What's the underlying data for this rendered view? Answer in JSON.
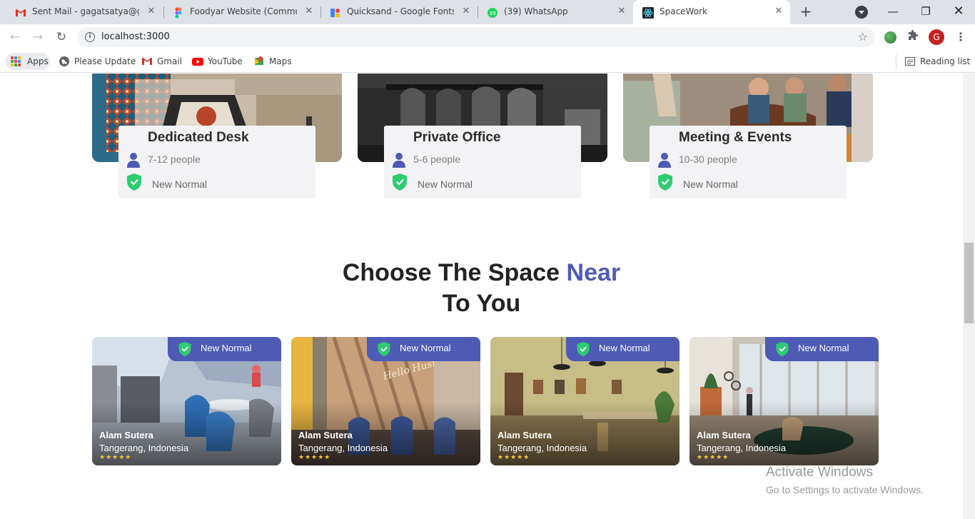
{
  "browser": {
    "tabs": [
      {
        "title": "Sent Mail - gagatsatya@gmail.com",
        "icon": "gmail-icon"
      },
      {
        "title": "Foodyar Website (Community)",
        "icon": "figma-icon"
      },
      {
        "title": "Quicksand - Google Fonts",
        "icon": "google-fonts-icon"
      },
      {
        "title": "(39) WhatsApp",
        "icon": "whatsapp-icon"
      },
      {
        "title": "SpaceWork",
        "icon": "react-icon",
        "active": true
      }
    ],
    "url": "localhost:3000",
    "profile_initial": "G",
    "bookmarks": {
      "apps": "Apps",
      "items": [
        {
          "label": "Please Update",
          "icon": "globe-icon"
        },
        {
          "label": "Gmail",
          "icon": "gmail-icon"
        },
        {
          "label": "YouTube",
          "icon": "youtube-icon"
        },
        {
          "label": "Maps",
          "icon": "maps-icon"
        }
      ],
      "reading_list": "Reading list"
    }
  },
  "services": [
    {
      "title": "Dedicated Desk",
      "people": "7-12 people",
      "badge": "New Normal"
    },
    {
      "title": "Private Office",
      "people": "5-6 people",
      "badge": "New Normal"
    },
    {
      "title": "Meeting & Events",
      "people": "10-30 people",
      "badge": "New Normal"
    }
  ],
  "section": {
    "title_part1": "Choose The Space",
    "title_accent": "Near",
    "title_part2": "To You"
  },
  "spaces": [
    {
      "badge": "New Normal",
      "name": "Alam Sutera",
      "location": "Tangerang, Indonesia",
      "rating": "★★★★★"
    },
    {
      "badge": "New Normal",
      "name": "Alam Sutera",
      "location": "Tangerang, Indonesia",
      "rating": "★★★★★"
    },
    {
      "badge": "New Normal",
      "name": "Alam Sutera",
      "location": "Tangerang, Indonesia",
      "rating": "★★★★★"
    },
    {
      "badge": "New Normal",
      "name": "Alam Sutera",
      "location": "Tangerang, Indonesia",
      "rating": "★★★★★"
    }
  ],
  "watermark": {
    "line1": "Activate Windows",
    "line2": "Go to Settings to activate Windows."
  },
  "colors": {
    "accent": "#4d5bb5",
    "shield": "#2ecc71",
    "star": "#f5c542"
  }
}
